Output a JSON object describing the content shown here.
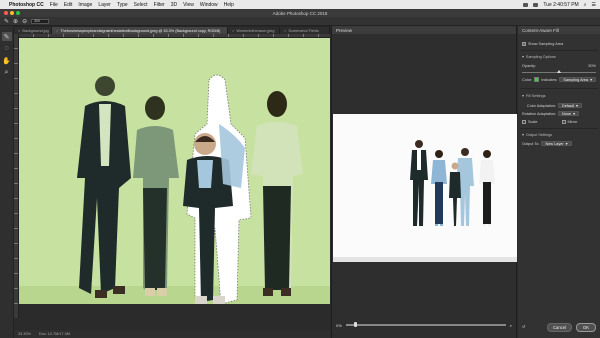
{
  "menubar": {
    "app_name": "Photoshop CC",
    "items": [
      "File",
      "Edit",
      "Image",
      "Layer",
      "Type",
      "Select",
      "Filter",
      "3D",
      "View",
      "Window",
      "Help"
    ],
    "clock": "Tue 2:40:57 PM"
  },
  "titlebar": {
    "title": "Adobe Photoshop CC 2018"
  },
  "options": {
    "brush_size": "300"
  },
  "tabs": [
    {
      "label": "Background.jpg",
      "active": false
    },
    {
      "label": "Thebusinesspeopleandsignsinthestaticellbackground.jpeg @ 33.3% (Background copy, RGB/8)",
      "active": true
    },
    {
      "label": "Womenintheraum.jpeg",
      "active": false
    },
    {
      "label": "Screenshot Fields",
      "active": false
    }
  ],
  "document": {
    "zoom": "33.33%",
    "doc_size": "Doc: 12.7M/17.3M"
  },
  "preview": {
    "title": "Preview",
    "zoom_label": "0%",
    "zoom_value": 0.05
  },
  "panel": {
    "title": "Content-Aware Fill",
    "show_sampling_area": "Show Sampling Area",
    "sampling_options": "Sampling Options",
    "opacity_label": "Opacity:",
    "opacity_value": "50%",
    "opacity_level": 0.5,
    "color_label": "Color:",
    "indicates_label": "Indicates:",
    "indicates_value": "Sampling Area",
    "fill_settings": "Fill Settings",
    "color_adaptation_label": "Color Adaptation:",
    "color_adaptation_value": "Default",
    "rotation_label": "Rotation Adaptation:",
    "rotation_value": "None",
    "scale_label": "Scale",
    "mirror_label": "Mirror",
    "output_settings": "Output Settings",
    "output_to_label": "Output To:",
    "output_to_value": "New Layer",
    "cancel": "Cancel",
    "ok": "OK"
  },
  "colors": {
    "sampling_overlay": "#c7e2a0",
    "sampling_swatch": "#3ccf3c",
    "suit": "#1f2a2a",
    "blue_shirt": "#a5c7dd"
  }
}
